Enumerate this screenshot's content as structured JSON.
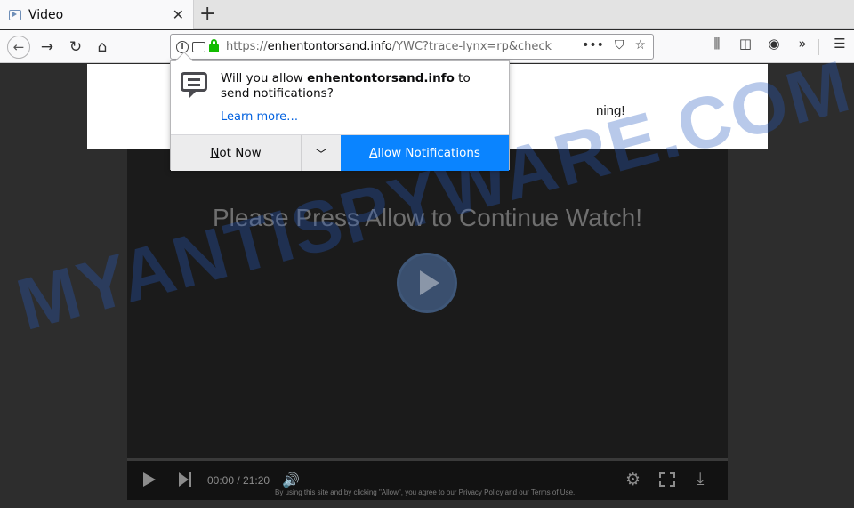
{
  "browser": {
    "tab_title": "Video",
    "tab_close": "✕",
    "new_tab": "+",
    "url_scheme": "https://",
    "url_host": "enhentontorsand.info",
    "url_path": "/YWC?trace-lynx=rp&check",
    "page_actions": "•••"
  },
  "popup": {
    "message_prefix": "Will you allow ",
    "message_host": "enhentontorsand.info",
    "message_suffix": " to send notifications?",
    "learn_more": "Learn more…",
    "not_now_accesskey": "N",
    "not_now_rest": "ot Now",
    "allow_accesskey": "A",
    "allow_rest": "llow Notifications"
  },
  "page": {
    "banner_text_partial": "ning!",
    "player_message": "Please Press Allow to Continue Watch!",
    "time_current": "00:00",
    "time_total": "21:20",
    "legal_text": "By using this site and by clicking \"Allow\", you agree to our Privacy Policy and our Terms of Use.",
    "watermark": "MYANTISPYWARE.COM"
  }
}
